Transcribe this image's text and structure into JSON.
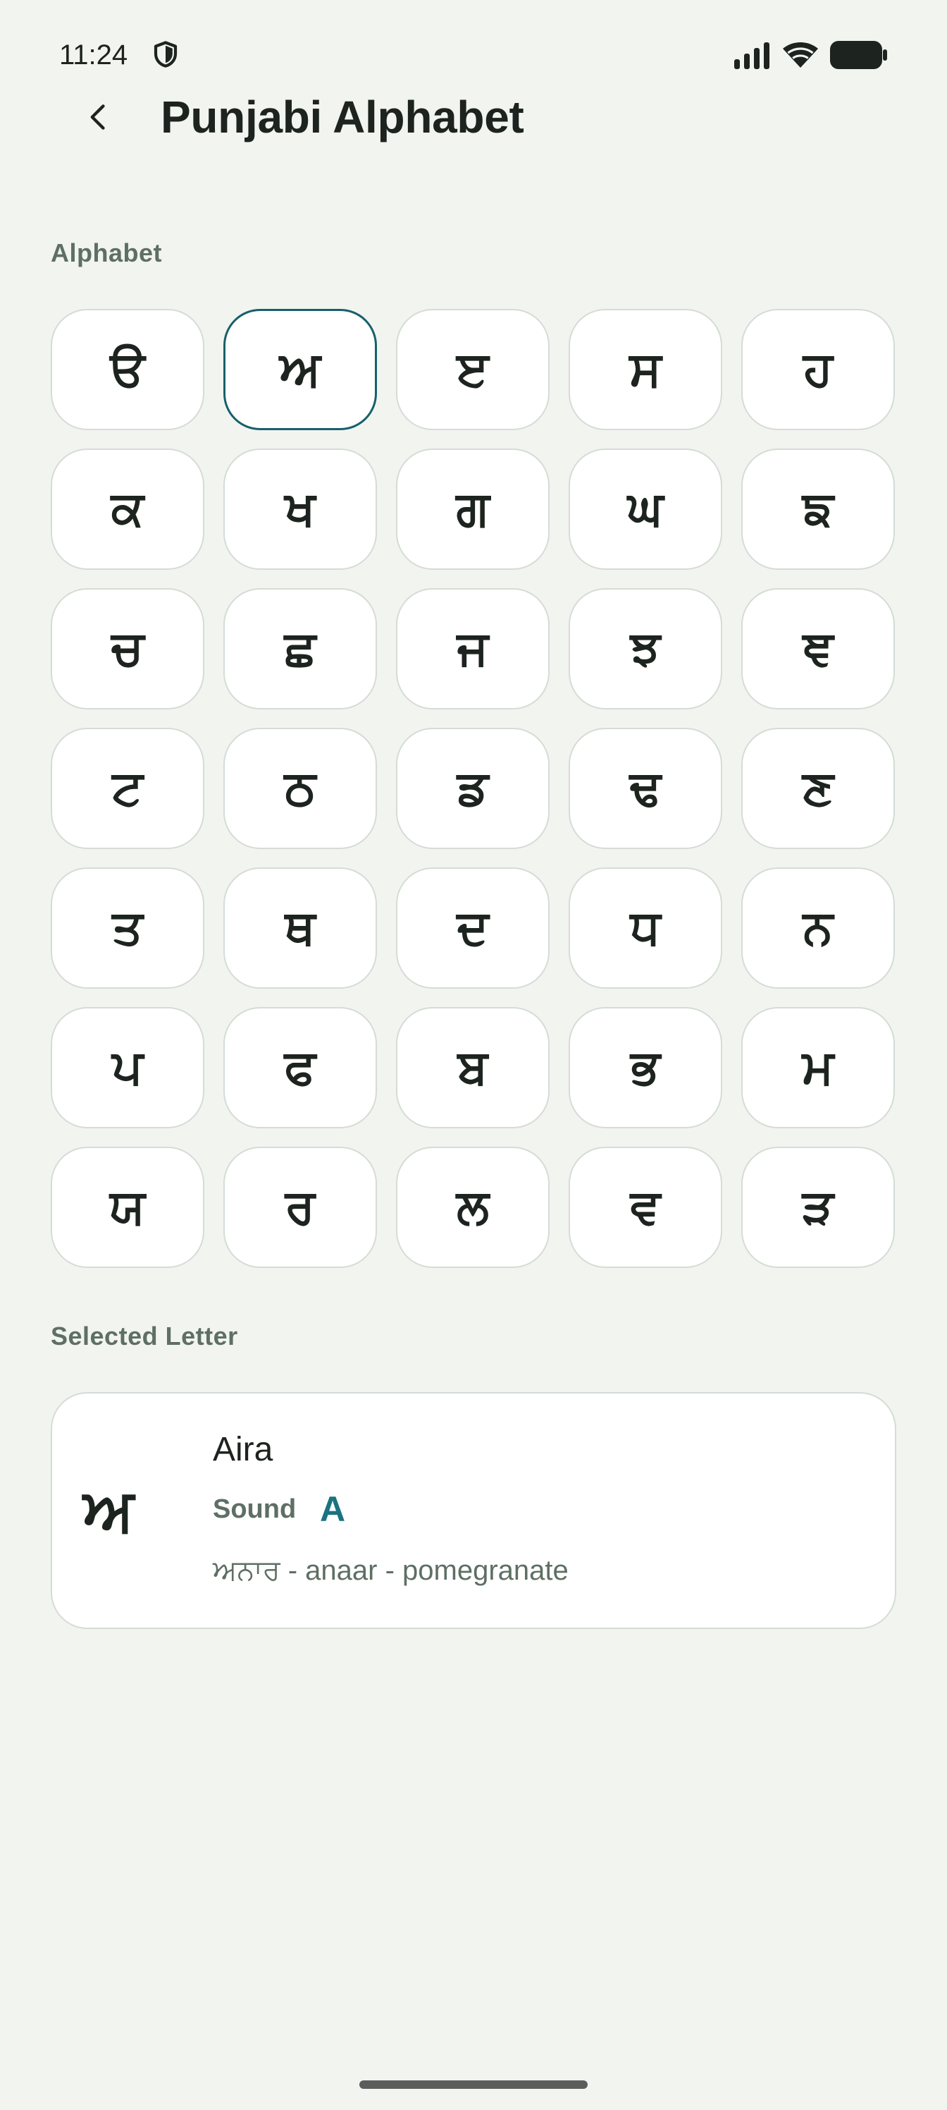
{
  "status_bar": {
    "time": "11:24",
    "icons": [
      "shield-icon",
      "signal-icon",
      "wifi-icon",
      "battery-icon"
    ]
  },
  "app_bar": {
    "back_icon": "back-arrow-icon",
    "title": "Punjabi Alphabet"
  },
  "alphabet": {
    "label": "Alphabet",
    "selected_letter": "ਅ",
    "letters": [
      "ੳ",
      "ਅ",
      "ੲ",
      "ਸ",
      "ਹ",
      "ਕ",
      "ਖ",
      "ਗ",
      "ਘ",
      "ਙ",
      "ਚ",
      "ਛ",
      "ਜ",
      "ਝ",
      "ਞ",
      "ਟ",
      "ਠ",
      "ਡ",
      "ਢ",
      "ਣ",
      "ਤ",
      "ਥ",
      "ਦ",
      "ਧ",
      "ਨ",
      "ਪ",
      "ਫ",
      "ਬ",
      "ਭ",
      "ਮ",
      "ਯ",
      "ਰ",
      "ਲ",
      "ਵ",
      "ੜ"
    ]
  },
  "selected": {
    "label": "Selected Letter",
    "letter": "ਅ",
    "name": "Aira",
    "sound_label": "Sound",
    "sound_value": "A",
    "example": "ਅਨਾਰ - anaar - pomegranate"
  },
  "colors": {
    "background": "#f2f4f0",
    "accent": "#17606b",
    "sound_accent": "#1a7380",
    "muted_text": "#5e6f63",
    "tile_border": "#d5dcd5"
  }
}
